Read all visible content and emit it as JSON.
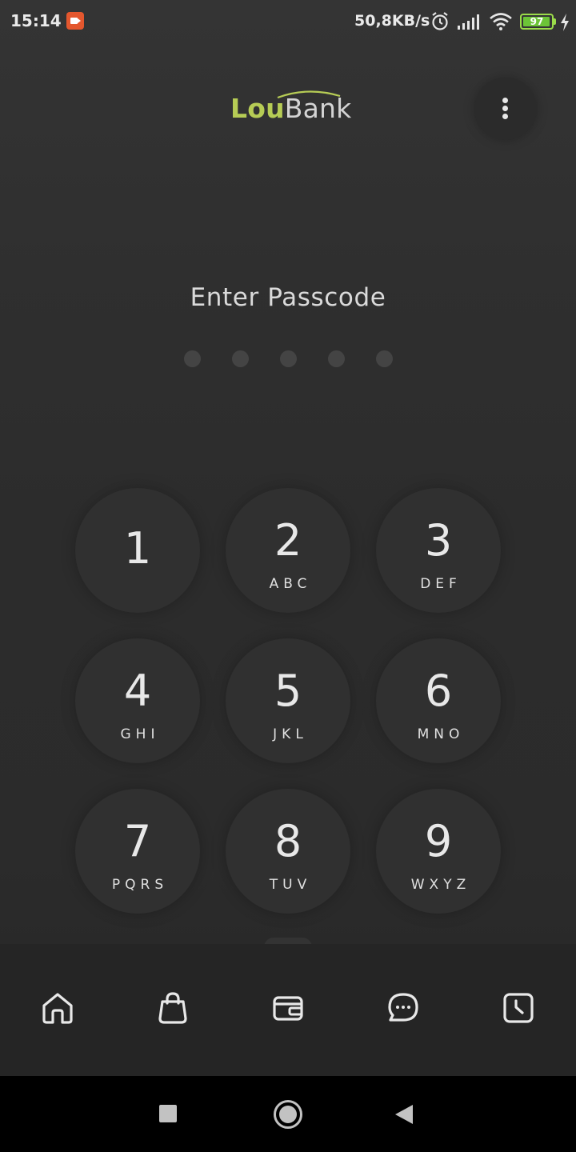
{
  "status_bar": {
    "time": "15:14",
    "net_speed": "50,8KB/s",
    "battery_level": "97",
    "icons": [
      "screen-record-icon",
      "alarm-icon",
      "signal-icon",
      "wifi-icon",
      "battery-icon",
      "charging-icon"
    ]
  },
  "header": {
    "logo_part1": "Lou",
    "logo_part2": "Bank",
    "menu_icon": "more-vertical-icon"
  },
  "passcode": {
    "prompt": "Enter Passcode",
    "length": 5,
    "entered": 0
  },
  "keypad": {
    "keys": [
      {
        "digit": "1",
        "letters": ""
      },
      {
        "digit": "2",
        "letters": "ABC"
      },
      {
        "digit": "3",
        "letters": "DEF"
      },
      {
        "digit": "4",
        "letters": "GHI"
      },
      {
        "digit": "5",
        "letters": "JKL"
      },
      {
        "digit": "6",
        "letters": "MNO"
      },
      {
        "digit": "7",
        "letters": "PQRS"
      },
      {
        "digit": "8",
        "letters": "TUV"
      },
      {
        "digit": "9",
        "letters": "WXYZ"
      }
    ]
  },
  "bottom_nav": {
    "items": [
      {
        "icon": "home-icon"
      },
      {
        "icon": "shopping-bag-icon"
      },
      {
        "icon": "wallet-icon"
      },
      {
        "icon": "chat-icon"
      },
      {
        "icon": "history-clock-icon"
      }
    ]
  },
  "system_nav": {
    "icons": [
      "recents-icon",
      "home-button-icon",
      "back-icon"
    ]
  },
  "colors": {
    "accent": "#b6cc55",
    "background": "#2e2e2e",
    "key": "#303030",
    "nav_bar": "#252525"
  }
}
